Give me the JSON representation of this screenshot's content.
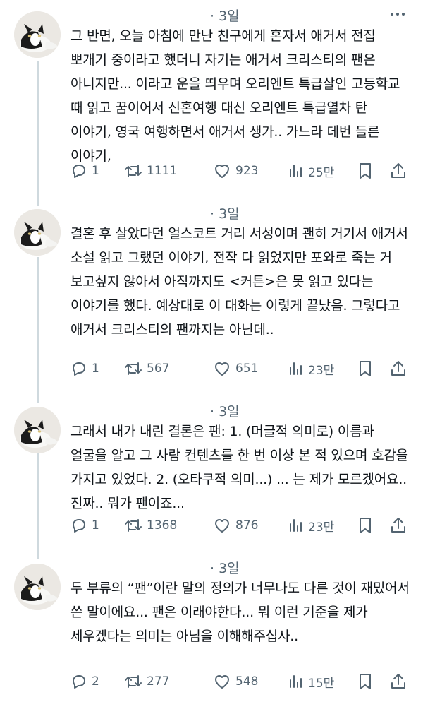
{
  "posts": [
    {
      "time": "· 3일",
      "text": "그 반면, 오늘 아침에 만난 친구에게 혼자서 애거서  전집 뽀개기 중이라고 했더니 자기는 애거서 크리스티의 팬은 아니지만... 이라고 운을 띄우며 오리엔트 특급살인 고등학교 때 읽고 꿈이어서 신혼여행 대신 오리엔트 특급열차 탄 이야기, 영국 여행하면서 애거서 생가.. 가느라 데번 들른 이야기,",
      "replies": "1",
      "reposts": "1111",
      "likes": "923",
      "views": "25만"
    },
    {
      "time": "· 3일",
      "text": "결혼 후 살았다던 얼스코트 거리 서성이며 괜히 거기서 애거서 소설 읽고 그랬던 이야기, 전작 다 읽었지만 포와로 죽는 거 보고싶지 않아서 아직까지도 <커튼>은 못 읽고 있다는 이야기를 했다. 예상대로 이 대화는 이렇게 끝났음. 그렇다고 애거서 크리스티의 팬까지는 아닌데..",
      "replies": "1",
      "reposts": "567",
      "likes": "651",
      "views": "23만"
    },
    {
      "time": "· 3일",
      "text": "그래서 내가 내린 결론은 팬: 1. (머글적 의미로) 이름과 얼굴을 알고 그 사람 컨텐츠를 한 번 이상 본 적 있으며 호감을 가지고 있었다. 2. (오타쿠적 의미...) ... 는 제가 모르겠어요.. 진짜.. 뭐가 팬이죠...",
      "replies": "1",
      "reposts": "1368",
      "likes": "876",
      "views": "23만"
    },
    {
      "time": "· 3일",
      "text": "두 부류의 “팬”이란 말의 정의가 너무나도 다른 것이 재밌어서 쓴 말이에요... 팬은 이래야한다... 뭐 이런 기준을 제가 세우겠다는 의미는 아님을 이해해주십사..",
      "replies": "2",
      "reposts": "277",
      "likes": "548",
      "views": "15만"
    }
  ],
  "icons": {
    "reply": "reply-icon",
    "repost": "repost-icon",
    "like": "heart-icon",
    "views": "views-icon",
    "bookmark": "bookmark-icon",
    "share": "share-icon",
    "more": "more-icon",
    "avatar": "cat-avatar"
  },
  "colors": {
    "text": "#0f1419",
    "muted": "#536471",
    "thread_line": "#cfd9de",
    "background": "#ffffff"
  }
}
